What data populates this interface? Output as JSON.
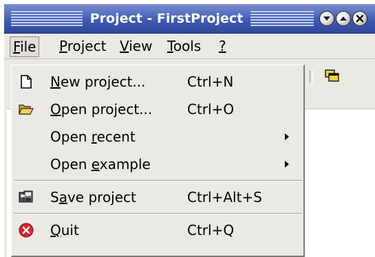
{
  "window": {
    "title": "Project - FirstProject"
  },
  "menubar": {
    "items": [
      {
        "pre": "",
        "mnemonic": "F",
        "post": "ile"
      },
      {
        "pre": "",
        "mnemonic": "P",
        "post": "roject"
      },
      {
        "pre": "",
        "mnemonic": "V",
        "post": "iew"
      },
      {
        "pre": "",
        "mnemonic": "T",
        "post": "ools"
      },
      {
        "pre": "",
        "mnemonic": "?",
        "post": ""
      }
    ]
  },
  "file_menu": {
    "items": [
      {
        "pre": "",
        "mnemonic": "N",
        "post": "ew project...",
        "accel": "Ctrl+N",
        "icon": "new-document-icon"
      },
      {
        "pre": "",
        "mnemonic": "O",
        "post": "pen project...",
        "accel": "Ctrl+O",
        "icon": "open-folder-icon"
      },
      {
        "pre": "Open ",
        "mnemonic": "r",
        "post": "ecent",
        "accel": "",
        "icon": ""
      },
      {
        "pre": "Open ",
        "mnemonic": "e",
        "post": "xample",
        "accel": "",
        "icon": ""
      },
      {
        "pre": "S",
        "mnemonic": "a",
        "post": "ve project",
        "accel": "Ctrl+Alt+S",
        "icon": "save-icon"
      },
      {
        "pre": "",
        "mnemonic": "Q",
        "post": "uit",
        "accel": "Ctrl+Q",
        "icon": "quit-icon"
      }
    ]
  },
  "colors": {
    "titlebar": "#3f5bb5",
    "menu_bg": "#ebe9e4",
    "quit_red": "#d8262c"
  }
}
